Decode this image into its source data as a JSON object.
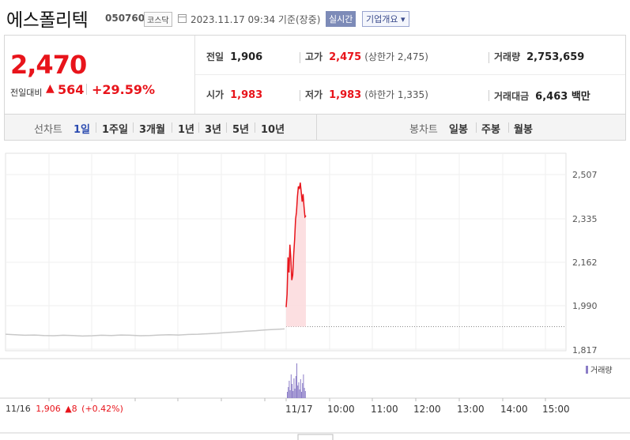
{
  "header": {
    "name": "에스폴리텍",
    "code": "050760",
    "market": "코스닥",
    "datetime": "2023.11.17 09:34 기준(장중)",
    "realtime_label": "실시간",
    "overview_label": "기업개요 ▾"
  },
  "summary": {
    "price": "2,470",
    "change_label": "전일대비",
    "change_arrow": "▲",
    "change_value": "564",
    "change_pct": "+29.59%",
    "prev_close_label": "전일",
    "prev_close": "1,906",
    "high_label": "고가",
    "high": "2,475",
    "upper_limit": "(상한가 2,475)",
    "volume_label": "거래량",
    "volume": "2,753,659",
    "open_label": "시가",
    "open": "1,983",
    "low_label": "저가",
    "low": "1,983",
    "lower_limit": "(하한가 1,335)",
    "amount_label": "거래대금",
    "amount": "6,463 백만"
  },
  "tabs": {
    "line_label": "선차트",
    "periods": [
      "1일",
      "1주일",
      "3개월",
      "1년",
      "3년",
      "5년",
      "10년"
    ],
    "active_period": "1일",
    "candle_label": "봉차트",
    "candles": [
      "일봉",
      "주봉",
      "월봉"
    ]
  },
  "chart_data": {
    "type": "line",
    "y_ticks": [
      "2,507",
      "2,335",
      "2,162",
      "1,990",
      "1,817"
    ],
    "ylim": [
      1817,
      2507
    ],
    "x_ticks": [
      "11/17",
      "10:00",
      "11:00",
      "12:00",
      "13:00",
      "14:00",
      "15:00"
    ],
    "prev_day_label": "11/16",
    "prev_day_close": "1,906",
    "prev_day_change": "▲8",
    "prev_day_pct": "(+0.42%)",
    "volume_legend": "거래량",
    "prev_day_series": [
      1876,
      1874,
      1872,
      1873,
      1871,
      1870,
      1872,
      1871,
      1869,
      1870,
      1872,
      1871,
      1873,
      1872,
      1870,
      1871,
      1873,
      1874,
      1873,
      1875,
      1876,
      1878,
      1880,
      1883,
      1885,
      1888,
      1890,
      1893,
      1895,
      1897
    ],
    "today_series": [
      1983,
      2035,
      2180,
      2120,
      2230,
      2175,
      2090,
      2110,
      2190,
      2250,
      2330,
      2360,
      2420,
      2460,
      2450,
      2475,
      2440,
      2400,
      2430,
      2380,
      2340,
      2345
    ],
    "reference_line": 1906,
    "colors": {
      "line_today": "#e8141b",
      "fill_today": "#fbd9dc",
      "line_prev": "#c8c8c8",
      "volume": "#8b7dc7"
    }
  }
}
